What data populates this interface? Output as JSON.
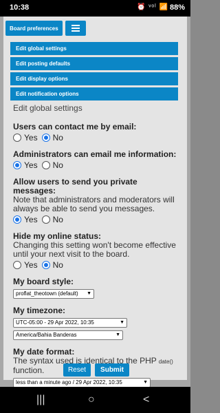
{
  "status": {
    "time": "10:38",
    "icons": "⏰ ᵛᵒˡ 📶",
    "battery": "88%"
  },
  "tabs": {
    "board_prefs": "Board preferences"
  },
  "nav": [
    "Edit global settings",
    "Edit posting defaults",
    "Edit display options",
    "Edit notification options"
  ],
  "section_title": "Edit global settings",
  "yes": "Yes",
  "no": "No",
  "q1": {
    "label": "Users can contact me by email:"
  },
  "q2": {
    "label": "Administrators can email me information:"
  },
  "q3": {
    "label": "Allow users to send you private messages:",
    "note": "Note that administrators and moderators will always be able to send you messages."
  },
  "q4": {
    "label": "Hide my online status:",
    "note": "Changing this setting won't become effective until your next visit to the board."
  },
  "style": {
    "label": "My board style:",
    "value": "proflat_theotown (default)"
  },
  "tz": {
    "label": "My timezone:",
    "value1": "UTC-05:00 - 29 Apr 2022, 10:35",
    "value2": "America/Bahia Banderas"
  },
  "datefmt": {
    "label": "My date format:",
    "note1": "The syntax used is identical to the PHP ",
    "note_code": "date()",
    "note2": "function.",
    "value": "less than a minute ago / 29 Apr 2022, 10:35"
  },
  "buttons": {
    "reset": "Reset",
    "submit": "Submit"
  },
  "navbar": {
    "recents": "|||",
    "home": "○",
    "back": "<"
  }
}
